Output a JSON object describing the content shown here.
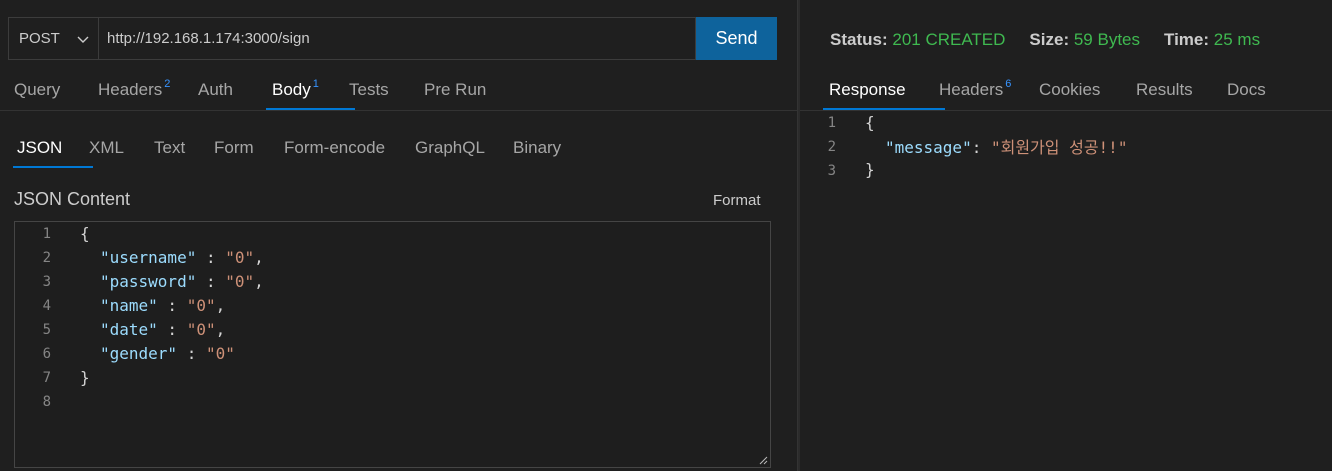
{
  "request": {
    "method": "POST",
    "url": "http://192.168.1.174:3000/sign",
    "send_label": "Send"
  },
  "request_tabs": [
    {
      "label": "Query",
      "badge": ""
    },
    {
      "label": "Headers",
      "badge": "2"
    },
    {
      "label": "Auth",
      "badge": ""
    },
    {
      "label": "Body",
      "badge": "1"
    },
    {
      "label": "Tests",
      "badge": ""
    },
    {
      "label": "Pre Run",
      "badge": ""
    }
  ],
  "body_tabs": [
    "JSON",
    "XML",
    "Text",
    "Form",
    "Form-encode",
    "GraphQL",
    "Binary"
  ],
  "body": {
    "content_label": "JSON Content",
    "format_label": "Format",
    "line_numbers": [
      "1",
      "2",
      "3",
      "4",
      "5",
      "6",
      "7",
      "8"
    ],
    "fields": [
      {
        "key": "\"username\"",
        "value": "\"0\""
      },
      {
        "key": "\"password\"",
        "value": "\"0\""
      },
      {
        "key": "\"name\"",
        "value": "\"0\""
      },
      {
        "key": "\"date\"",
        "value": "\"0\""
      },
      {
        "key": "\"gender\"",
        "value": "\"0\""
      }
    ]
  },
  "status": {
    "status_label": "Status:",
    "status_value": "201 CREATED",
    "size_label": "Size:",
    "size_value": "59 Bytes",
    "time_label": "Time:",
    "time_value": "25 ms"
  },
  "response_tabs": [
    {
      "label": "Response",
      "badge": ""
    },
    {
      "label": "Headers",
      "badge": "6"
    },
    {
      "label": "Cookies",
      "badge": ""
    },
    {
      "label": "Results",
      "badge": ""
    },
    {
      "label": "Docs",
      "badge": ""
    }
  ],
  "response": {
    "line_numbers": [
      "1",
      "2",
      "3"
    ],
    "key": "\"message\"",
    "value": "\"회원가입 성공!!\""
  },
  "colors": {
    "accent": "#0078d4",
    "send_button": "#0e639c",
    "status_green": "#3fb950",
    "json_key": "#9cdcfe",
    "json_string": "#ce9178"
  },
  "icons": {
    "method_dropdown": "chevron-down-icon",
    "editor_resize": "resize-handle-icon"
  }
}
